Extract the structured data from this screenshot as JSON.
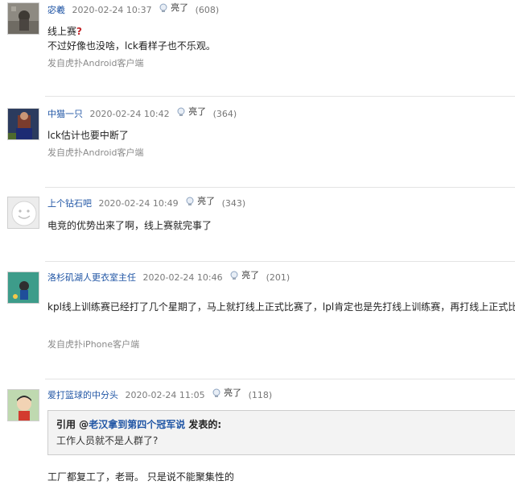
{
  "light_label": "亮了",
  "posts": [
    {
      "user": "宓羲",
      "time": "2020-02-24 10:37",
      "light_count": "(608)",
      "content_line1": "线上赛",
      "content_line1_mark": "?",
      "content_line2": "不过好像也没啥，lck看样子也不乐观。",
      "device": "发自虎扑Android客户端"
    },
    {
      "user": "中猫一只",
      "time": "2020-02-24 10:42",
      "light_count": "(364)",
      "content_line1": "lck估计也要中断了",
      "device": "发自虎扑Android客户端"
    },
    {
      "user": "上个钻石吧",
      "time": "2020-02-24 10:49",
      "light_count": "(343)",
      "content_line1": "电竞的优势出来了啊，线上赛就完事了"
    },
    {
      "user": "洛杉矶湖人更衣室主任",
      "time": "2020-02-24 10:46",
      "light_count": "(201)",
      "content_line1": "kpl线上训练赛已经打了几个星期了，马上就打线上正式比赛了，lpl肯定也是先打线上训练赛，再打线上正式比赛",
      "device": "发自虎扑iPhone客户端"
    },
    {
      "user": "爱打篮球的中分头",
      "time": "2020-02-24 11:05",
      "light_count": "(118)",
      "quote_prefix": "引用 @",
      "quote_user": "老汉拿到第四个冠军说",
      "quote_suffix": " 发表的:",
      "quote_text": "工作人员就不是人群了?",
      "content_line1": "工厂都复工了，老哥。 只是说不能聚集性的"
    }
  ],
  "colors": {
    "username": "#2156a5",
    "question_mark": "#c3272b",
    "quote_bg": "#f3f3f3",
    "divider": "#e3e3e3"
  },
  "icons": [
    "lightbulb-icon"
  ]
}
